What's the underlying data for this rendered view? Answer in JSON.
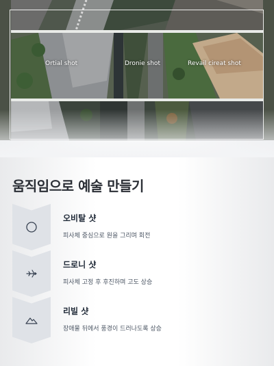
{
  "hero": {
    "labels": [
      "Ortial shot",
      "Dronie shot",
      "Revail cireat shot"
    ]
  },
  "heading": "움직임으로 예술 만들기",
  "steps": [
    {
      "icon": "circle-icon",
      "title": "오비탈 샷",
      "desc": "피사체 중심으로 원을 그리며 회전"
    },
    {
      "icon": "airplane-icon",
      "title": "드로니 샷",
      "desc": "피사체 고정 후 후진하며 고도 상승"
    },
    {
      "icon": "mountain-icon",
      "title": "리빌 샷",
      "desc": "장애물 뒤에서 풍경이 드러나도록 상승"
    }
  ]
}
